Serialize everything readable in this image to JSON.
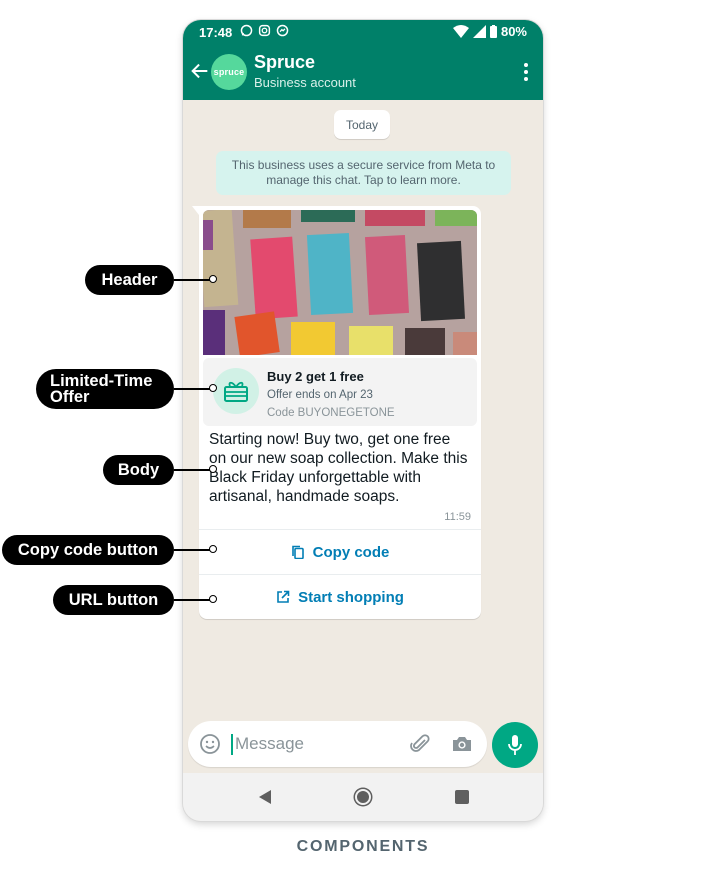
{
  "status_bar": {
    "time": "17:48",
    "battery": "80%"
  },
  "header": {
    "contact_name": "Spruce",
    "subtitle": "Business account",
    "avatar_text": "spruce"
  },
  "chat": {
    "date_chip": "Today",
    "system_notice": "This business uses a secure service from Meta to manage this chat. Tap to learn more."
  },
  "message": {
    "offer": {
      "title": "Buy 2 get 1 free",
      "expiry": "Offer ends on Apr 23",
      "code": "Code BUYONEGETONE"
    },
    "body": "Starting now! Buy two, get one free on our new soap collection. Make this Black Friday unforgettable with artisanal, handmade soaps.",
    "time": "11:59",
    "buttons": {
      "copy_code": "Copy code",
      "url": "Start shopping"
    }
  },
  "composer": {
    "placeholder": "Message"
  },
  "callouts": {
    "header": "Header",
    "lto_line1": "Limited-Time",
    "lto_line2": "Offer",
    "body": "Body",
    "copy_code": "Copy code button",
    "url": "URL button"
  },
  "caption": "COMPONENTS",
  "colors": {
    "brand": "#008069",
    "accent": "#00a884",
    "link": "#027eb5",
    "chat_bg": "#efeae2"
  }
}
